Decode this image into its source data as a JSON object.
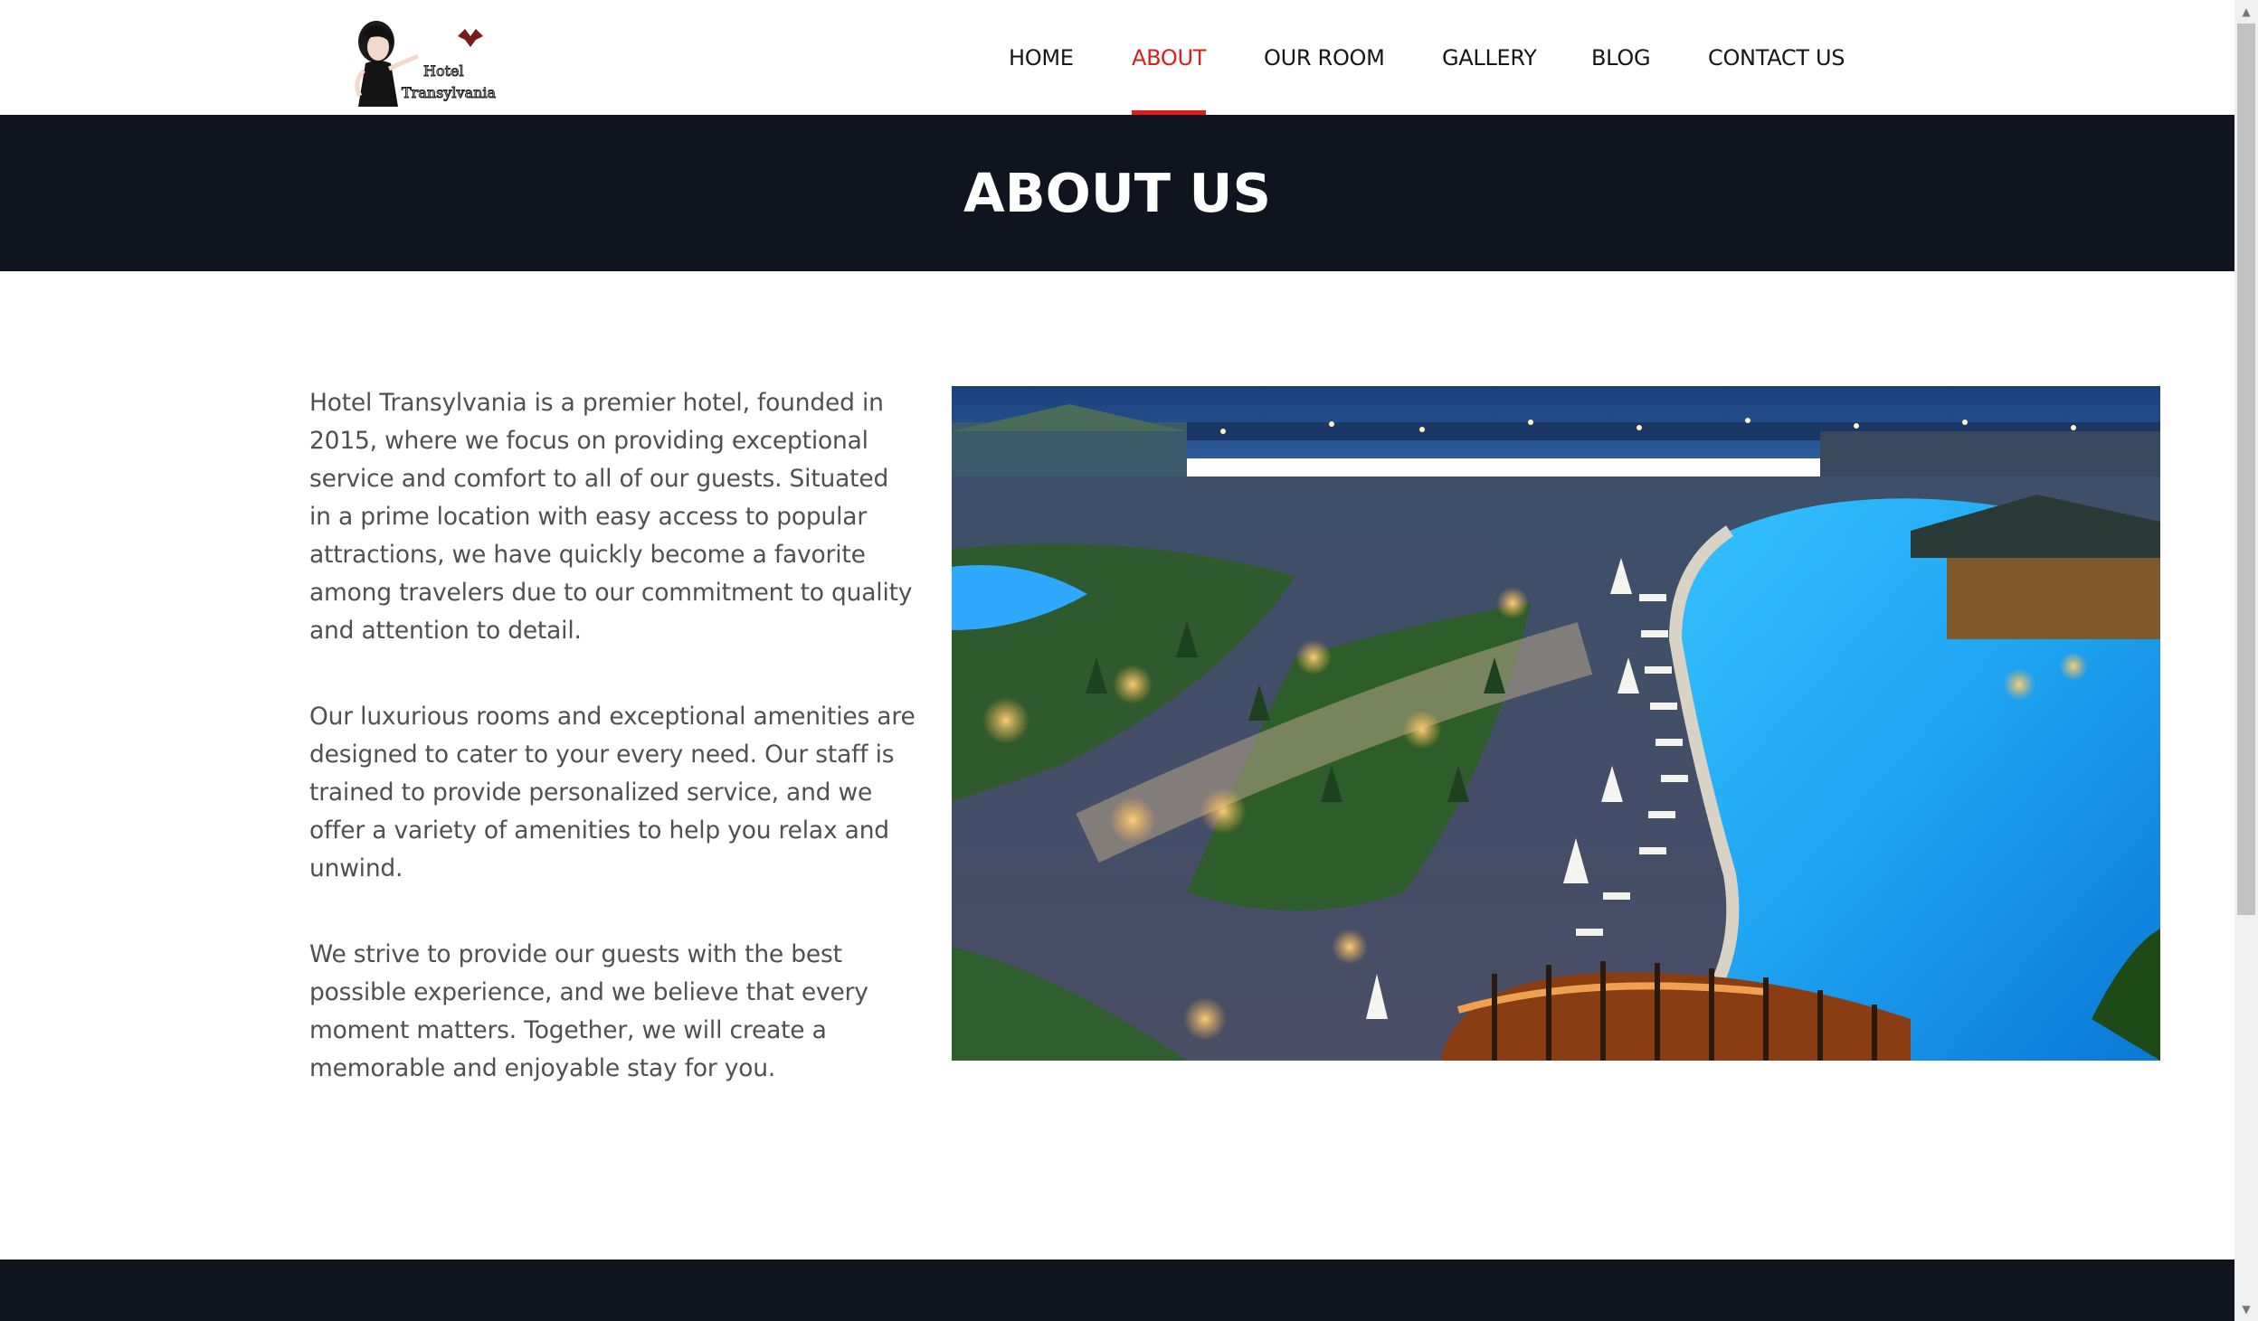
{
  "nav": {
    "items": [
      {
        "label": "HOME"
      },
      {
        "label": "ABOUT"
      },
      {
        "label": "OUR ROOM"
      },
      {
        "label": "GALLERY"
      },
      {
        "label": "BLOG"
      },
      {
        "label": "CONTACT US"
      }
    ],
    "active_index": 1
  },
  "logo": {
    "text_line1": "Hotel",
    "text_line2": "Transylvania"
  },
  "banner": {
    "title": "ABOUT US"
  },
  "content": {
    "paragraphs": [
      "Hotel Transylvania is a premier hotel, founded in 2015, where we focus on providing exceptional service and comfort to all of our guests. Situated in a prime location with easy access to popular attractions, we have quickly become a favorite among travelers due to our commitment to quality and attention to detail.",
      "Our luxurious rooms and exceptional amenities are designed to cater to your every need. Our staff is trained to provide personalized service, and we offer a variety of amenities to help you relax and unwind.",
      "We strive to provide our guests with the best possible experience, and we believe that every moment matters. Together, we will create a memorable and enjoyable stay for you."
    ]
  },
  "colors": {
    "accent": "#e21b1b",
    "dark": "#10141f",
    "text": "#505050"
  }
}
